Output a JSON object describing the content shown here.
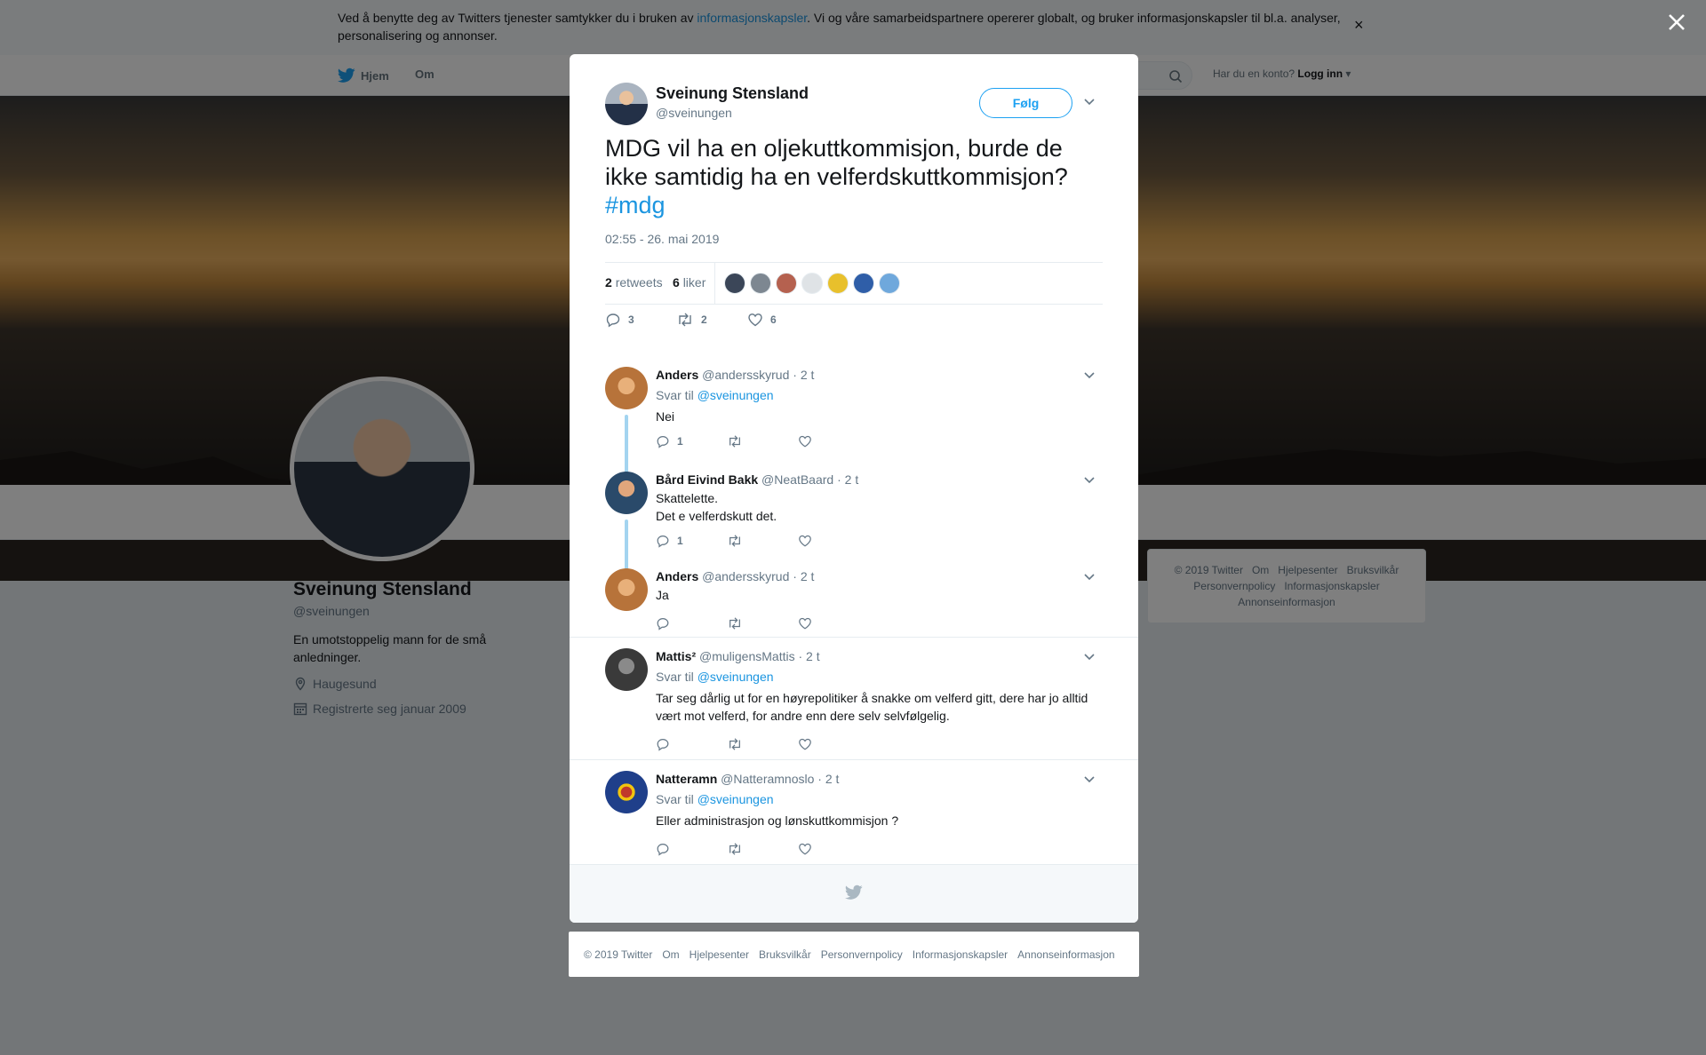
{
  "cookie_banner": {
    "text_before": "Ved å benytte deg av Twitters tjenester samtykker du i bruken av ",
    "link": "informasjonskapsler",
    "text_after": ". Vi og våre samarbeidspartnere opererer globalt, og bruker informasjonskapsler til bl.a. analyser, personalisering og annonser.",
    "close": "×"
  },
  "nav": {
    "home": "Hjem",
    "about": "Om",
    "account_prompt": "Har du en konto?",
    "login": "Logg inn"
  },
  "profile": {
    "name": "Sveinung Stensland",
    "handle": "@sveinungen",
    "bio": "En umotstoppelig mann for de små anledninger.",
    "location": "Haugesund",
    "joined": "Registrerte seg januar 2009"
  },
  "side_footer": {
    "items": [
      "© 2019 Twitter",
      "Om",
      "Hjelpesenter",
      "Bruksvilkår",
      "Personvernpolicy",
      "Informasjonskapsler",
      "Annonseinformasjon"
    ]
  },
  "tweet": {
    "author_name": "Sveinung Stensland",
    "author_handle": "@sveinungen",
    "follow_label": "Følg",
    "text": "MDG vil ha en oljekuttkommisjon, burde de ikke samtidig ha en velferdskuttkommisjon?",
    "hashtag": "#mdg",
    "timestamp": "02:55 - 26. mai 2019",
    "retweets_count": "2",
    "retweets_label": "retweets",
    "likes_count": "6",
    "likes_label": "liker",
    "reply_count": "3",
    "retweet_count": "2",
    "like_count": "6",
    "liker_colors": [
      "#3b4658",
      "#7d8791",
      "#b5614f",
      "#dfe3e6",
      "#e8c02c",
      "#2f5ea8",
      "#6fa8dc"
    ]
  },
  "replies": [
    {
      "name": "Anders",
      "handle": "@andersskyrud",
      "time": "· 2 t",
      "reply_to_prefix": "Svar til",
      "reply_to": "@sveinungen",
      "text": "Nei",
      "reply_count": "1",
      "avatar_color": "#b7733a"
    },
    {
      "name": "Bård Eivind Bakk",
      "handle": "@NeatBaard",
      "time": "· 2 t",
      "text_line1": "Skattelette.",
      "text_line2": "Det e velferdskutt det.",
      "reply_count": "1",
      "avatar_color": "#2a4a6a"
    },
    {
      "name": "Anders",
      "handle": "@andersskyrud",
      "time": "· 2 t",
      "text": "Ja",
      "avatar_color": "#b7733a"
    },
    {
      "name": "Mattis²",
      "handle": "@muligensMattis",
      "time": "· 2 t",
      "reply_to_prefix": "Svar til",
      "reply_to": "@sveinungen",
      "text": "Tar seg dårlig ut for en høyrepolitiker å snakke om velferd gitt, dere har jo alltid vært mot velferd, for andre enn dere selv selvfølgelig.",
      "avatar_color": "#3a3a3a"
    },
    {
      "name": "Natteramn",
      "handle": "@Natteramnoslo",
      "time": "· 2 t",
      "reply_to_prefix": "Svar til",
      "reply_to": "@sveinungen",
      "text": "Eller administrasjon  og lønskuttkommisjon  ?",
      "avatar_color": "#1f3f8a"
    }
  ],
  "footer": {
    "items": [
      "© 2019 Twitter",
      "Om",
      "Hjelpesenter",
      "Bruksvilkår",
      "Personvernpolicy",
      "Informasjonskapsler",
      "Annonseinformasjon"
    ]
  },
  "colors": {
    "brand": "#1da1f2",
    "link": "#1b95e0",
    "thread_line": "#a3d4f0"
  }
}
